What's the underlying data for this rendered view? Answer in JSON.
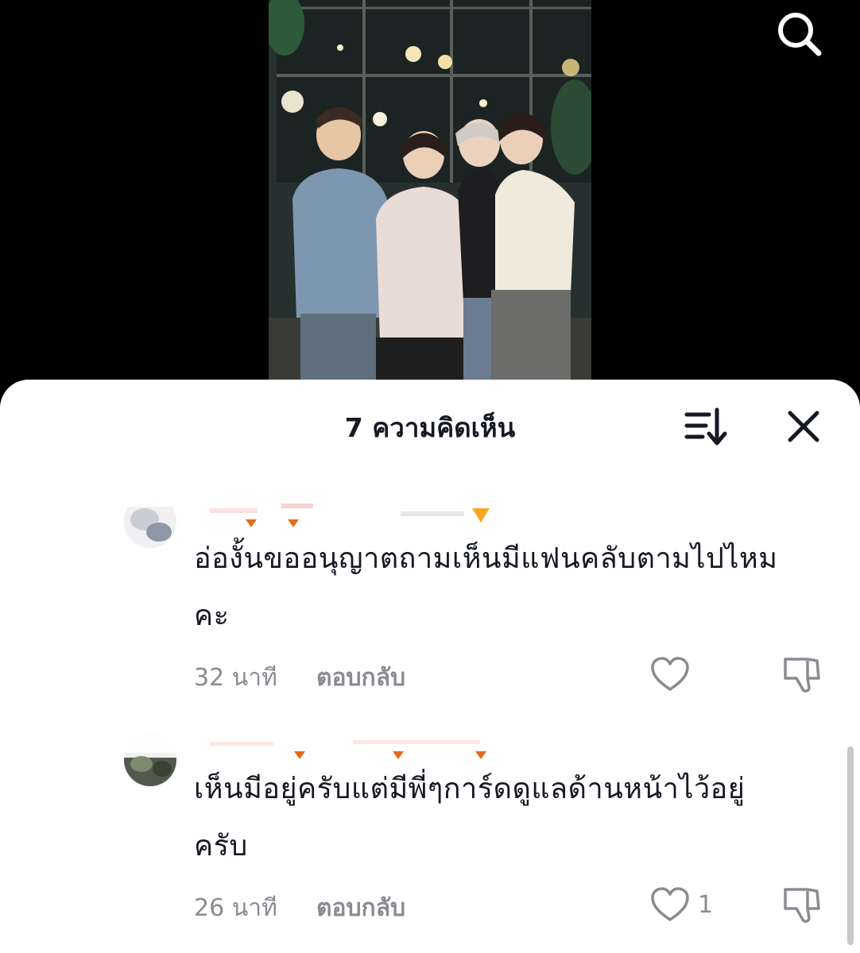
{
  "header": {
    "title": "7 ความคิดเห็น"
  },
  "icons": {
    "search": "search-icon",
    "sort": "sort-icon",
    "close": "close-icon",
    "like": "heart-icon",
    "dislike": "thumbs-down-icon"
  },
  "comments": [
    {
      "text_line1": "อ่องั้นขออนุญาตถามเห็นมีแฟนคลับตามไปไหม",
      "text_line2": "คะ",
      "time": "32 นาที",
      "reply_label": "ตอบกลับ",
      "likes": ""
    },
    {
      "text_line1": "เห็นมีอยู่ครับแต่มีพี่ๆการ์ดดูแลด้านหน้าไว้อยู่",
      "text_line2": "ครับ",
      "time": "26 นาที",
      "reply_label": "ตอบกลับ",
      "likes": "1"
    }
  ]
}
